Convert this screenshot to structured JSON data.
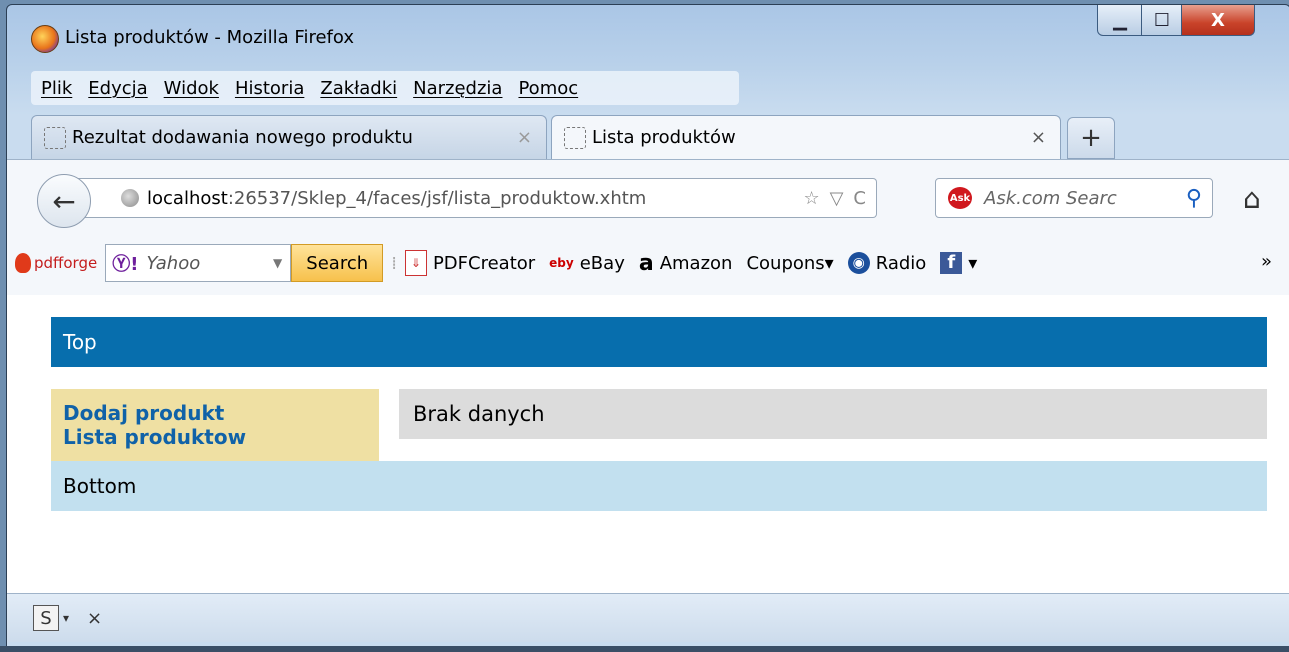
{
  "window": {
    "title": "Lista produktów - Mozilla Firefox",
    "controls": {
      "minimize": "▁",
      "maximize": "☐",
      "close": "X"
    }
  },
  "menu": [
    "Plik",
    "Edycja",
    "Widok",
    "Historia",
    "Zakładki",
    "Narzędzia",
    "Pomoc"
  ],
  "tabs": [
    {
      "label": "Rezultat dodawania nowego produktu",
      "active": false,
      "close": "×"
    },
    {
      "label": "Lista produktów",
      "active": true,
      "close": "×"
    }
  ],
  "new_tab": "+",
  "nav": {
    "back": "←",
    "url_host": "localhost",
    "url_path": ":26537/Sklep_4/faces/jsf/lista_produktow.xhtm",
    "star": "☆",
    "dropdown": "▽",
    "reload": "C",
    "search_placeholder": "Ask.com Searc",
    "search_logo": "Ask",
    "search_icon": "⚲",
    "home": "⌂"
  },
  "toolbar": {
    "pdfforge": "pdfforge",
    "yahoo_logo": "Ⓨ!",
    "yahoo_text": "Yahoo",
    "search_button": "Search",
    "items": [
      {
        "icon": "pdf",
        "glyph": "⇓",
        "label": "PDFCreator"
      },
      {
        "icon": "ebay",
        "glyph": "eby",
        "label": "eBay"
      },
      {
        "icon": "amz",
        "glyph": "a",
        "label": "Amazon"
      },
      {
        "icon": "none",
        "glyph": "",
        "label": "Coupons▾"
      },
      {
        "icon": "radio",
        "glyph": "◉",
        "label": "Radio"
      },
      {
        "icon": "fb",
        "glyph": "f",
        "label": "▾"
      }
    ],
    "more": "»"
  },
  "page": {
    "top": "Top",
    "nav_links": [
      "Dodaj produkt",
      "Lista produktow"
    ],
    "main": "Brak danych",
    "bottom": "Bottom"
  },
  "status": {
    "icon": "S",
    "arrow": "▾",
    "close": "×"
  }
}
